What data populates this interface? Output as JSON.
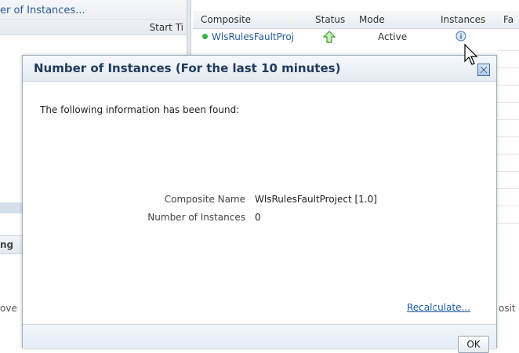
{
  "background": {
    "left_panel_title": "er of Instances...",
    "left_panel_column": "Start Ti",
    "table_headers": [
      "Composite",
      "Status",
      "Mode",
      "Instances",
      "Fa"
    ],
    "row": {
      "composite": "WlsRulesFaultProj",
      "mode": "Active"
    },
    "left_fragments": [
      "ng",
      "ove"
    ],
    "right_fragment": "osit"
  },
  "dialog": {
    "title": "Number of Instances (For the last 10 minutes)",
    "info_text": "The following information has been found:",
    "fields": [
      {
        "label": "Composite Name",
        "value": "WlsRulesFaultProject [1.0]"
      },
      {
        "label": "Number of Instances",
        "value": "0"
      }
    ],
    "recalculate_label": "Recalculate...",
    "ok_label": "OK"
  },
  "icons": {
    "status": "arrow-up-green-icon",
    "instances": "info-icon",
    "close": "close-icon",
    "cursor": "mouse-pointer-icon"
  },
  "colors": {
    "link": "#1a5aa8",
    "title": "#1f3b5c",
    "status_dot": "#36b34a"
  }
}
